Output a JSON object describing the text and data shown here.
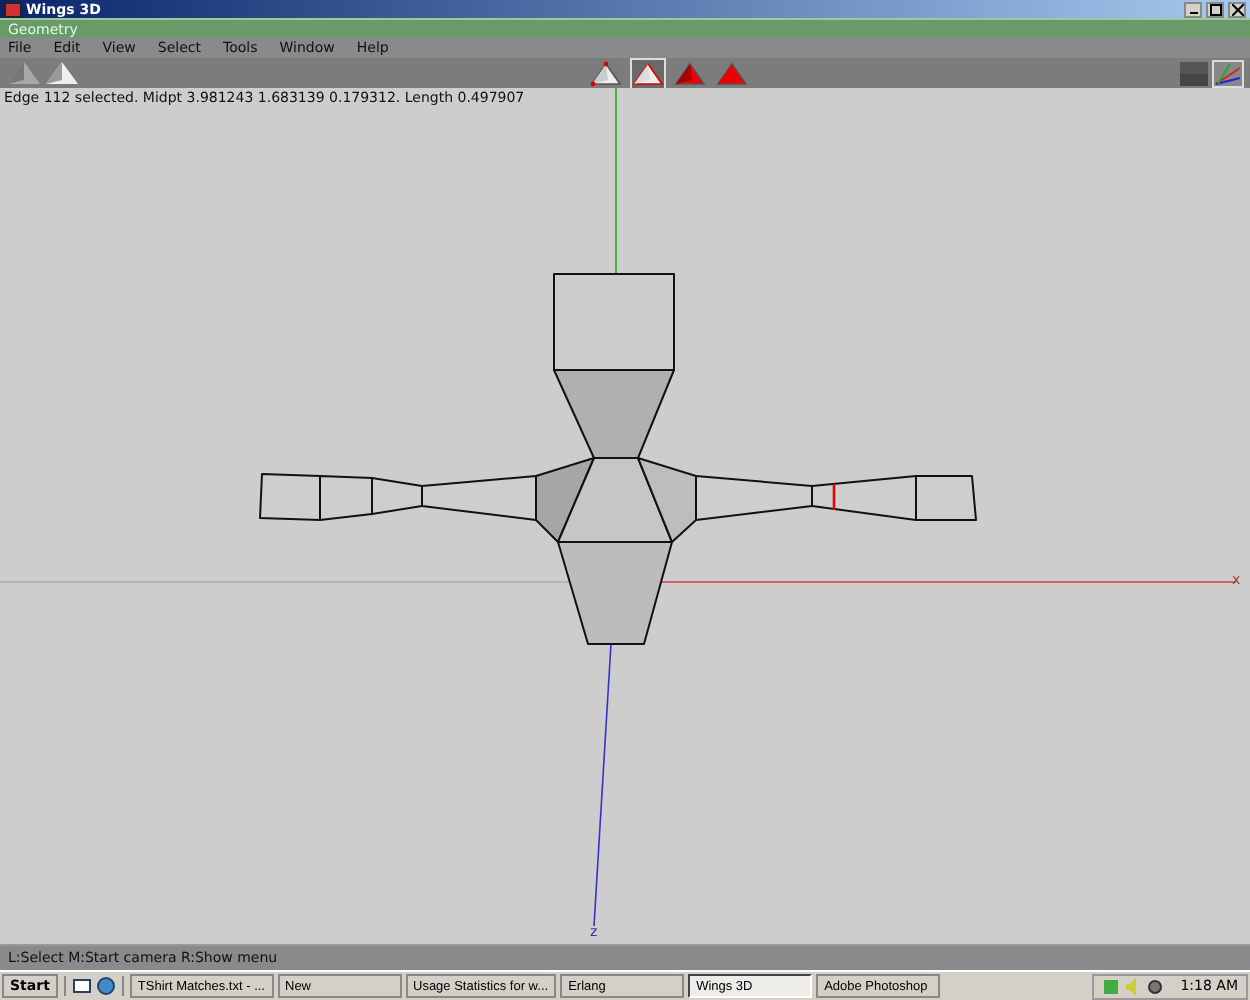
{
  "window": {
    "title": "Wings 3D"
  },
  "geometry_window": {
    "title": "Geometry"
  },
  "menu": [
    "File",
    "Edit",
    "View",
    "Select",
    "Tools",
    "Window",
    "Help"
  ],
  "selection_modes": [
    {
      "kind": "vertex",
      "selected": false
    },
    {
      "kind": "edge",
      "selected": true
    },
    {
      "kind": "face",
      "selected": false
    },
    {
      "kind": "body",
      "selected": false
    }
  ],
  "status_message": "Edge 112 selected. Midpt 3.981243 1.683139 0.179312. Length 0.497907",
  "axis_labels": [
    "x",
    "z"
  ],
  "help_line": "L:Select  M:Start camera  R:Show menu",
  "taskbar": {
    "start": "Start",
    "tasks": [
      {
        "label": "TShirt Matches.txt - ...",
        "selected": false
      },
      {
        "label": "New",
        "selected": false
      },
      {
        "label": "Usage Statistics for w...",
        "selected": false
      },
      {
        "label": "Erlang",
        "selected": false
      },
      {
        "label": "Wings 3D",
        "selected": true
      },
      {
        "label": "Adobe Photoshop",
        "selected": false
      }
    ],
    "clock": "1:18 AM"
  }
}
